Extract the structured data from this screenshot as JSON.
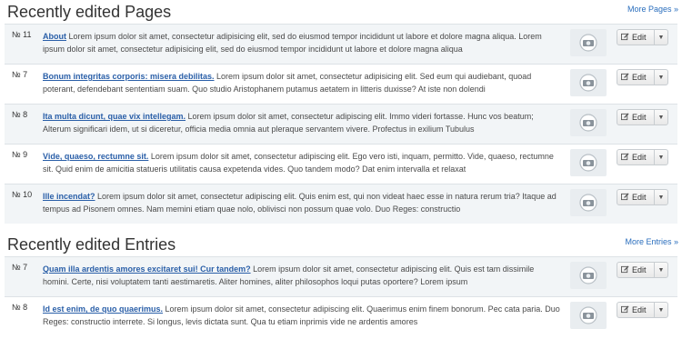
{
  "pages": {
    "heading": "Recently edited Pages",
    "more": "More Pages »",
    "items": [
      {
        "num": "№ 11",
        "title": "About",
        "body": " Lorem ipsum dolor sit amet, consectetur adipisicing elit, sed do eiusmod tempor incididunt ut labore et dolore magna aliqua. Lorem ipsum dolor sit amet, consectetur adipisicing elit, sed do eiusmod tempor incididunt ut labore et dolore magna aliqua",
        "edit": "Edit"
      },
      {
        "num": "№ 7",
        "title": "Bonum integritas corporis: misera debilitas.",
        "body": " Lorem ipsum dolor sit amet, consectetur adipisicing elit. Sed eum qui audiebant, quoad poterant, defendebant sententiam suam. Quo studio Aristophanem putamus aetatem in litteris duxisse? At iste non dolendi",
        "edit": "Edit"
      },
      {
        "num": "№ 8",
        "title": "Ita multa dicunt, quae vix intellegam.",
        "body": " Lorem ipsum dolor sit amet, consectetur adipiscing elit. Immo videri fortasse. Hunc vos beatum; Alterum significari idem, ut si diceretur, officia media omnia aut pleraque servantem vivere. Profectus in exilium Tubulus",
        "edit": "Edit"
      },
      {
        "num": "№ 9",
        "title": "Vide, quaeso, rectumne sit.",
        "body": " Lorem ipsum dolor sit amet, consectetur adipiscing elit. Ego vero isti, inquam, permitto. Vide, quaeso, rectumne sit. Quid enim de amicitia statueris utilitatis causa expetenda vides. Quo tandem modo? Dat enim intervalla et relaxat",
        "edit": "Edit"
      },
      {
        "num": "№ 10",
        "title": "Ille incendat?",
        "body": " Lorem ipsum dolor sit amet, consectetur adipiscing elit. Quis enim est, qui non videat haec esse in natura rerum tria? Itaque ad tempus ad Pisonem omnes. Nam memini etiam quae nolo, oblivisci non possum quae volo. Duo Reges: constructio",
        "edit": "Edit"
      }
    ]
  },
  "entries": {
    "heading": "Recently edited Entries",
    "more": "More Entries »",
    "items": [
      {
        "num": "№ 7",
        "title": "Quam illa ardentis amores excitaret sui! Cur tandem?",
        "body": " Lorem ipsum dolor sit amet, consectetur adipiscing elit. Quis est tam dissimile homini. Certe, nisi voluptatem tanti aestimaretis. Aliter homines, aliter philosophos loqui putas oportere? Lorem ipsum",
        "edit": "Edit"
      },
      {
        "num": "№ 8",
        "title": "Id est enim, de quo quaerimus.",
        "body": " Lorem ipsum dolor sit amet, consectetur adipiscing elit. Quaerimus enim finem bonorum. Pec cata paria. Duo Reges: constructio interrete. Si longus, levis dictata sunt. Qua tu etiam inprimis vide ne ardentis amores",
        "edit": "Edit"
      }
    ]
  },
  "icons": {
    "thumb": "image-placeholder-icon",
    "pencil": "pencil-icon",
    "caret": "caret-down-icon"
  }
}
